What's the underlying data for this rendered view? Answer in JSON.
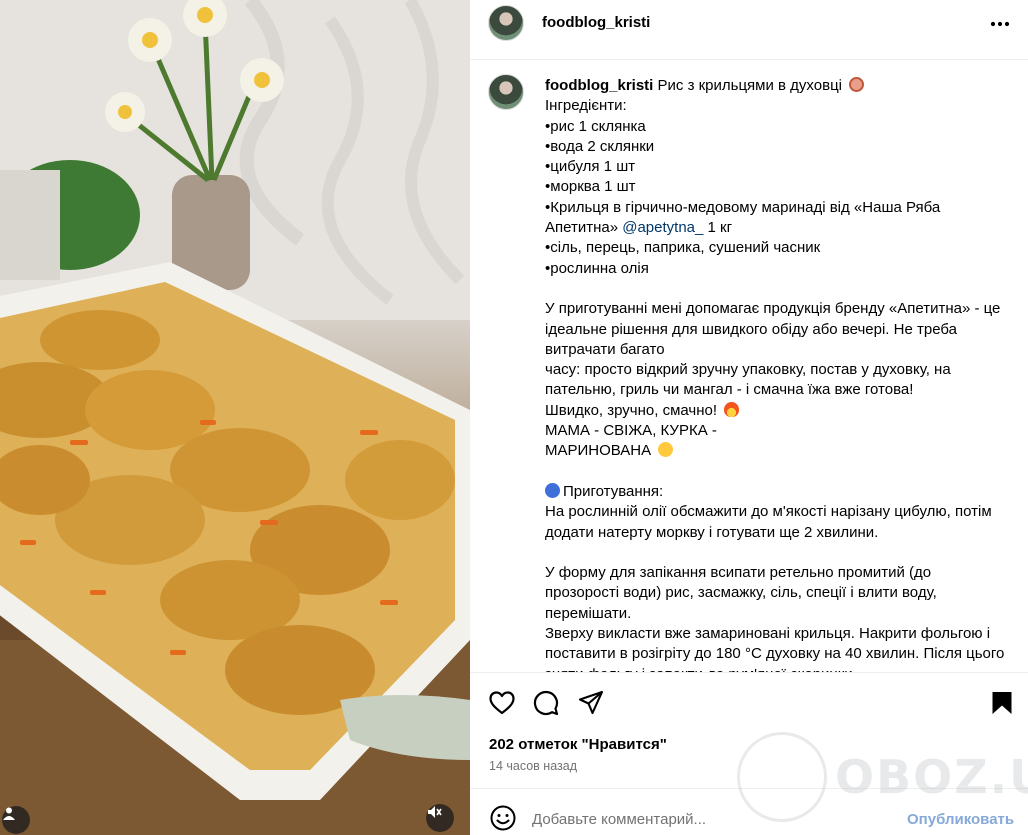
{
  "post": {
    "username": "foodblog_kristi"
  },
  "caption": {
    "author": "foodblog_kristi",
    "title": "Рис з крильцями в духовці",
    "lines": [
      "Інгредієнти:",
      "•рис 1 склянка",
      "•вода 2 склянки",
      "•цибуля 1 шт",
      "•морква 1 шт",
      "•Крильця в гірчично-медовому маринаді від «Наша Ряба Апетитна»"
    ],
    "mention": "@apetytna_",
    "mention_suffix": " 1 кг",
    "lines2": [
      "•сіль, перець, паприка, сушений часник",
      "•рослинна олія"
    ],
    "para1": "У приготуванні мені допомагає продукція бренду «Апетитна» - це ідеальне рішення для швидкого обіду або вечері. Не треба витрачати багато",
    "para2": "часу: просто відкрий зручну упаковку, постав у духовку, на пательню, гриль чи мангал - і смачна їжа вже готова!",
    "para3": "Швидко, зручно, смачно!",
    "para4": "МАМА - СВІЖА, КУРКА -",
    "para5": "МАРИНОВАНА",
    "prep_title": "Приготування:",
    "prep1": "На рослинній олії обсмажити до м'якості нарізану цибулю, потім додати натерту моркву і готувати ще 2 хвилини.",
    "prep2": "У форму для запікання всипати ретельно промитий (до прозорості води) рис, засмажку, сіль, спеції і влити воду, перемішати.",
    "prep3": "Зверху викласти вже замариновані крильця. Накрити фольгою і поставити в розігріту до 180 °С духовку на 40 хвилин. Після цього зняти фольгу і запекти до рум'яної скоринки."
  },
  "stats": {
    "likes": "202 отметок \"Нравится\"",
    "time": "14 часов назад"
  },
  "comment": {
    "placeholder": "Добавьте комментарий...",
    "publish": "Опубликовать"
  },
  "watermark": "OBOZ.UA",
  "colors": {
    "link": "#00376b",
    "publish": "#86a9d9",
    "muted": "#737373"
  }
}
